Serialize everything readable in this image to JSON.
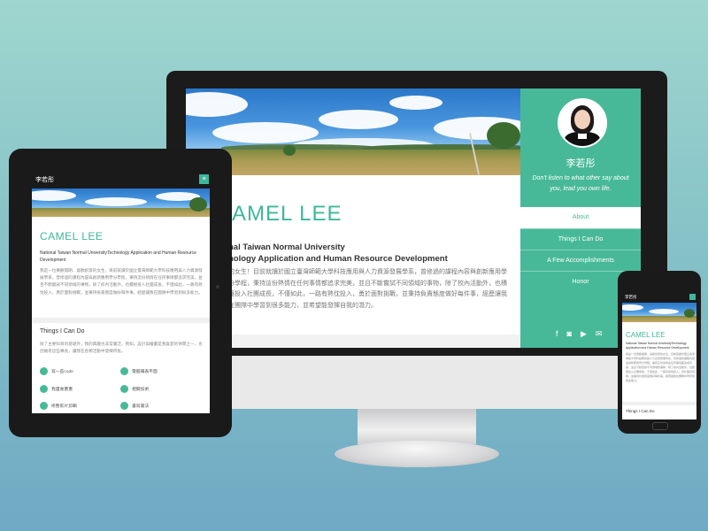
{
  "profile": {
    "name": "CAMEL LEE",
    "chinese_name": "李若彤",
    "quote": "Don't listen to what other say about you, lead you own life.",
    "school_line1": "National Taiwan Normal University",
    "school_line2": "Technology Application and Human Resource Development",
    "bio": "我是一位樂觀開朗、喜歡創意的女生，目前就讀於國立臺灣師範大學科技應用與人力資源發展學系，曾修過的課程內容與創新應用學分學程，秉持這份熱情在任何事情都追求完美，並且不斷嘗試不同領域的事物，除了校內活動外，也積極投入社團成長，不僅如此，一路有熱忱投入，勇於面對挑戰，並秉持負責態度做好每件事，經歷讓我在團隊中學習到很多能力。"
  },
  "desktop": {
    "nav": [
      "About",
      "Things I Can Do",
      "A Few Accomplishments",
      "Honor"
    ],
    "name_visible": "AMEL LEE",
    "school_visible_1": "nal Taiwan Normal University",
    "school_visible_2": "nology Application and Human Resource Development",
    "bio_visible": "的女生！目前就讀於國立臺灣師範大學科技應用與人力資源發展學系，曾修過的課程內容與創新應用學分學程，秉持這份熱情在任何事情都追求完美，並且不斷嘗試不同領域的事物，除了校內活動外，也積極投入社團成長，不僅如此，一路有熱忱投入，勇於面對挑戰，並秉持負責態度做好每件事，經歷讓我在團隊中學習到很多能力，並希望能發揮自我的潛力。"
  },
  "tablet": {
    "title": "李若彤",
    "name": "CAMEL LEE",
    "school": "National Taiwan Normal UniversityTechnology Application and Human Resource Development",
    "things_heading": "Things I Can Do",
    "things_text": "除了主要科目的基礎外，我的興趣也非常廣泛，例如，設計與繪畫是我喜愛的休閒之一，也因擁有這些專長，讓我在各類活動中發揮所長。",
    "skills": [
      "寫一些code",
      "電腦報表平面",
      "我還會畫畫",
      "相關技術",
      "修整影片剪輯",
      "書寫書法"
    ]
  },
  "phone": {
    "title": "李若彤",
    "name": "CAMEL LEE",
    "school": "National Taiwan Normal UniversityTechnology Application and Human Resource Development",
    "things_heading": "Things I Can Do"
  },
  "icons": {
    "social": [
      "facebook-icon",
      "instagram-icon",
      "youtube-icon",
      "mail-icon"
    ],
    "menu": "hamburger-icon"
  },
  "colors": {
    "accent": "#48b998",
    "title_green": "#3db89a",
    "device_black": "#1b1b1b"
  }
}
